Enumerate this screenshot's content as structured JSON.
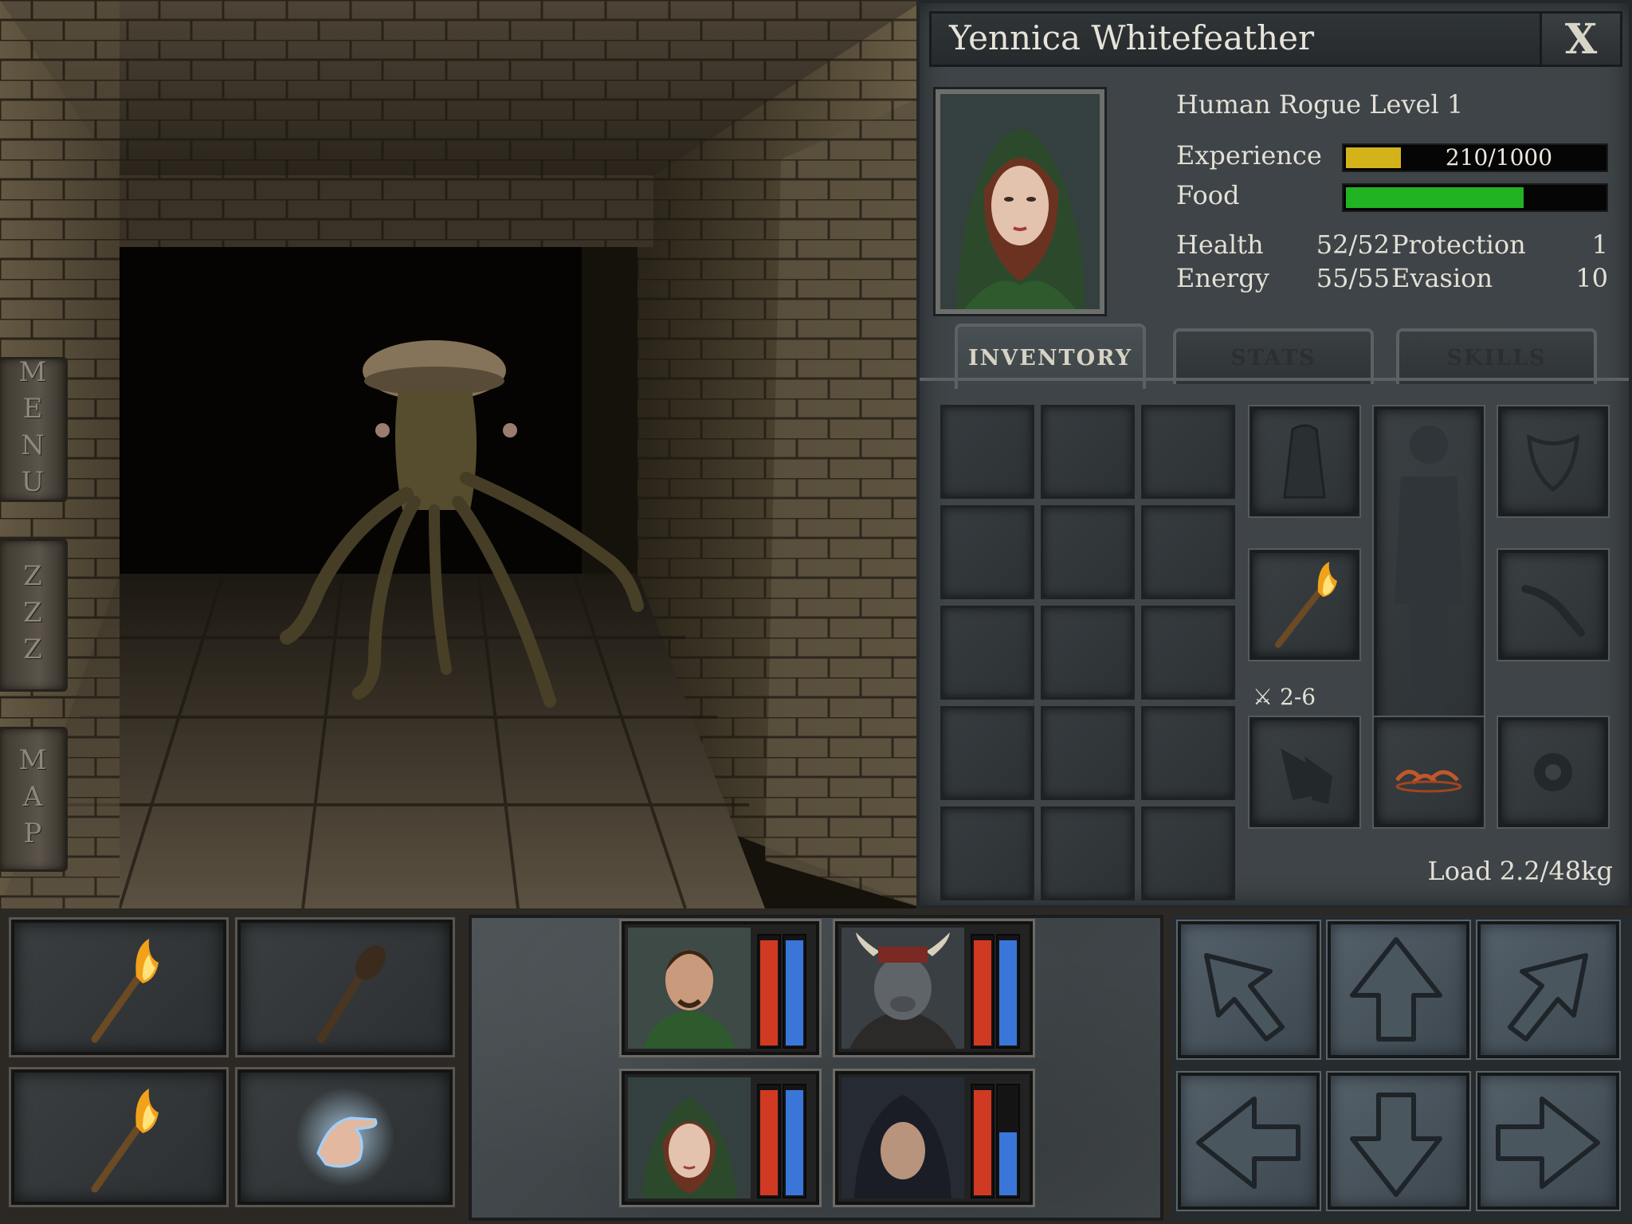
{
  "side_tabs": [
    {
      "label": "MENU"
    },
    {
      "label": "ZZZ"
    },
    {
      "label": "MAP"
    }
  ],
  "character": {
    "name": "Yennica Whitefeather",
    "close_label": "X",
    "class_line": "Human Rogue Level 1",
    "experience": {
      "label": "Experience",
      "value": "210/1000",
      "fraction": 0.21,
      "color": "#d4b21a"
    },
    "food": {
      "label": "Food",
      "fraction": 0.68,
      "color": "#22b322"
    },
    "stats": [
      {
        "label": "Health",
        "value": "52/52"
      },
      {
        "label": "Energy",
        "value": "55/55"
      }
    ],
    "defense": [
      {
        "label": "Protection",
        "value": "1"
      },
      {
        "label": "Evasion",
        "value": "10"
      }
    ],
    "tabs": [
      {
        "label": "INVENTORY",
        "active": true
      },
      {
        "label": "STATS",
        "active": false
      },
      {
        "label": "SKILLS",
        "active": false
      }
    ],
    "weapon_damage": "2-6",
    "load": "Load 2.2/48kg"
  },
  "hands": [
    {
      "item": "torch-icon"
    },
    {
      "item": "club-icon"
    },
    {
      "item": "torch-icon"
    },
    {
      "item": "open-hand-icon"
    }
  ],
  "party": [
    {
      "name": "member-1",
      "health": 1.0,
      "energy": 1.0
    },
    {
      "name": "member-2",
      "health": 1.0,
      "energy": 1.0
    },
    {
      "name": "member-3",
      "health": 1.0,
      "energy": 1.0
    },
    {
      "name": "member-4",
      "health": 1.0,
      "energy": 0.6
    }
  ],
  "colors": {
    "health": "#d13a22",
    "energy": "#3a76d8"
  },
  "movement": [
    "turn-left-icon",
    "forward-icon",
    "turn-right-icon",
    "strafe-left-icon",
    "backward-icon",
    "strafe-right-icon"
  ]
}
